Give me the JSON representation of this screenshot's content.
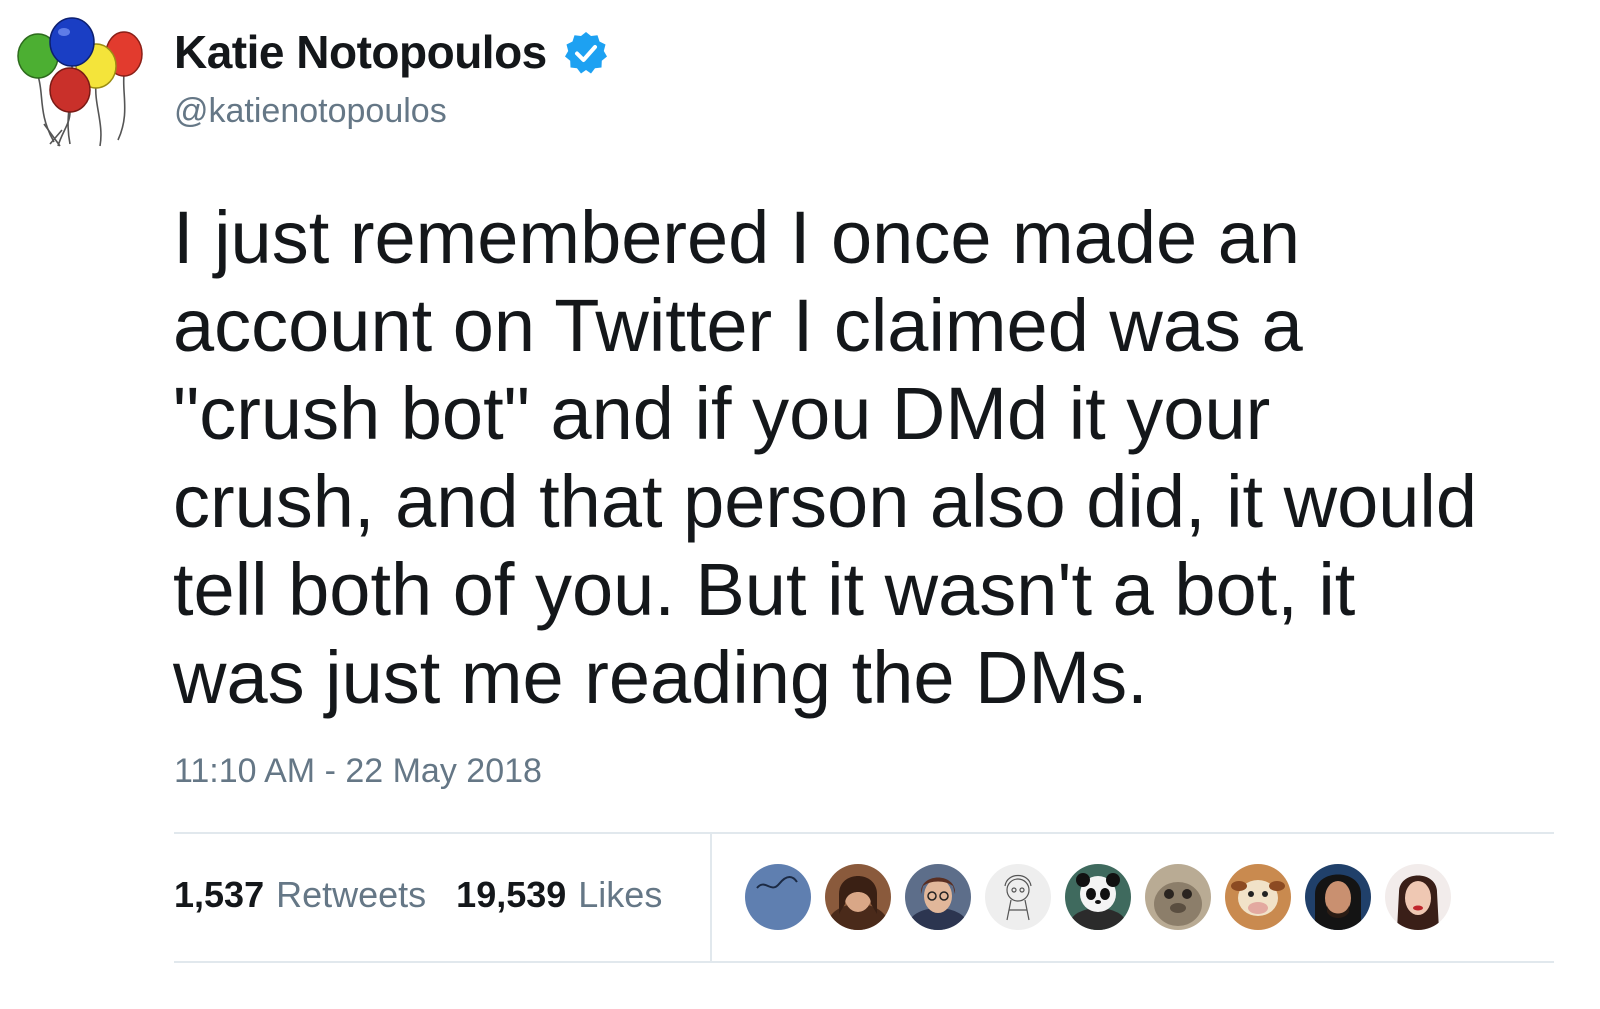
{
  "author": {
    "display_name": "Katie Notopoulos",
    "handle": "@katienotopoulos",
    "verified": true,
    "avatar_icon": "balloons-avatar-icon"
  },
  "tweet": {
    "text": "I just remembered I once made an\naccount on Twitter I claimed was a\n\"crush bot\" and if you DMd it your\ncrush, and that person also did, it would\ntell both of you. But it wasn't a bot, it\nwas just me reading the DMs.",
    "timestamp": "11:10 AM - 22 May 2018"
  },
  "stats": {
    "retweets_count": "1,537",
    "retweets_label": "Retweets",
    "likes_count": "19,539",
    "likes_label": "Likes"
  },
  "likers": [
    {
      "icon": "liker-avatar-1"
    },
    {
      "icon": "liker-avatar-2"
    },
    {
      "icon": "liker-avatar-3"
    },
    {
      "icon": "liker-avatar-4"
    },
    {
      "icon": "liker-avatar-5"
    },
    {
      "icon": "liker-avatar-6"
    },
    {
      "icon": "liker-avatar-7"
    },
    {
      "icon": "liker-avatar-8"
    },
    {
      "icon": "liker-avatar-9"
    }
  ],
  "colors": {
    "text_primary": "#14171a",
    "text_secondary": "#657786",
    "verified_blue": "#1da1f2",
    "divider": "#e1e8ed"
  }
}
